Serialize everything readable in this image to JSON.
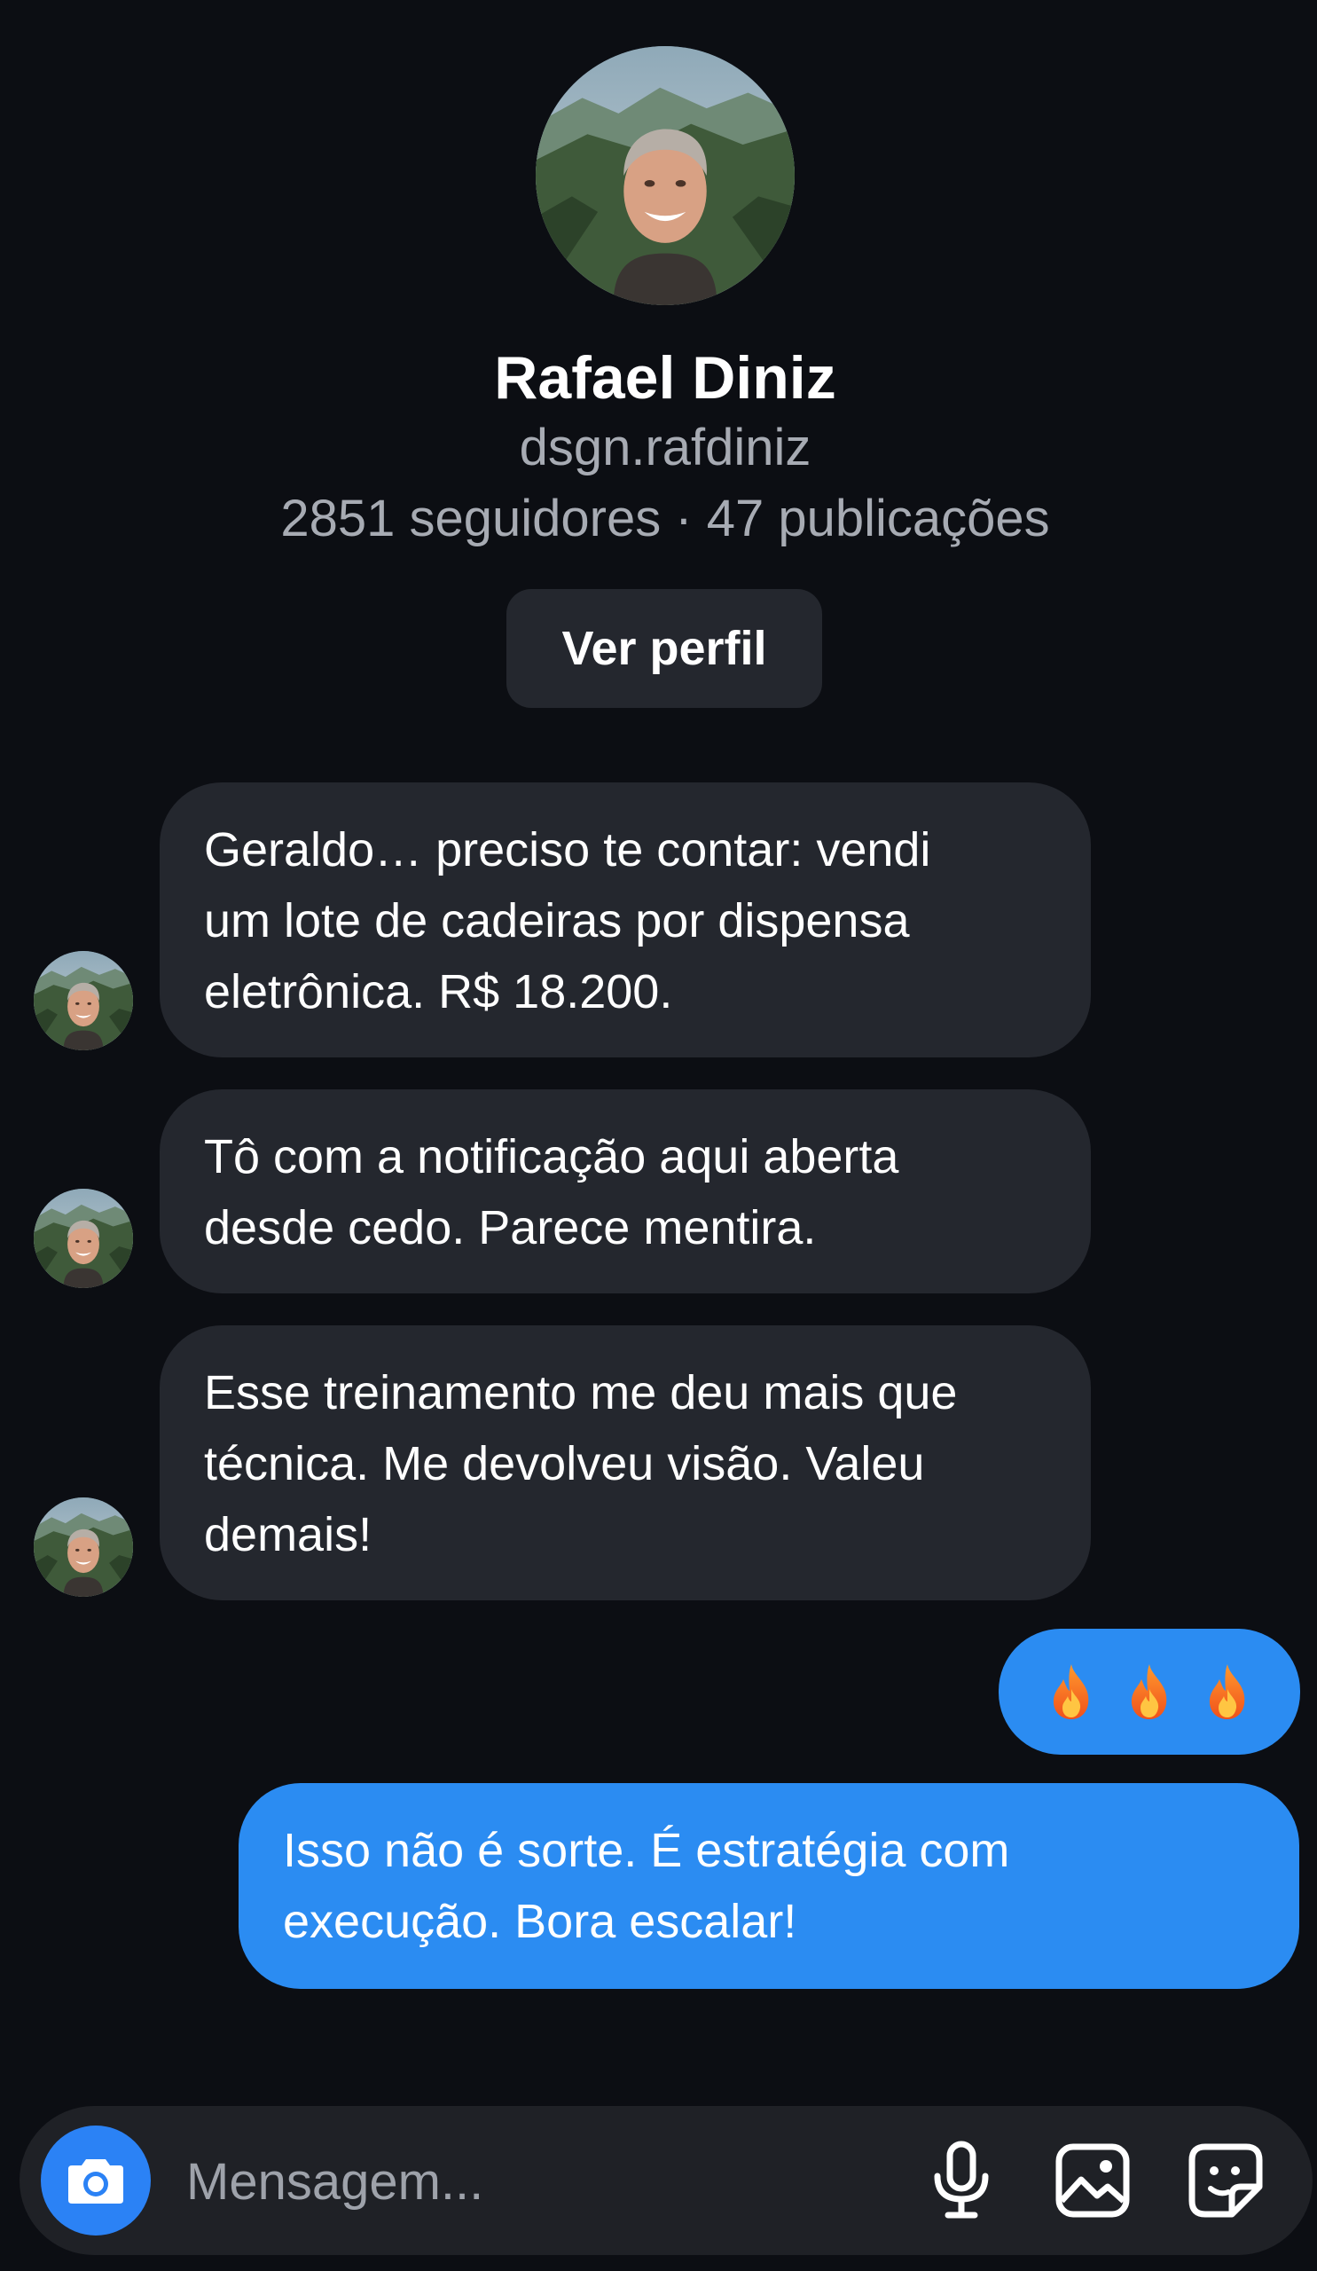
{
  "profile": {
    "name": "Rafael Diniz",
    "handle": "dsgn.rafdiniz",
    "stats": "2851 seguidores · 47 publicações",
    "view_profile_label": "Ver perfil"
  },
  "messages": [
    {
      "direction": "incoming",
      "text": "Geraldo… preciso te contar: vendi\num lote de cadeiras por dispensa\neletrônica. R$ 18.200."
    },
    {
      "direction": "incoming",
      "text": "Tô com a notificação aqui aberta\ndesde cedo. Parece mentira."
    },
    {
      "direction": "incoming",
      "text": "Esse treinamento me deu mais que\ntécnica. Me devolveu visão. Valeu\ndemais!"
    },
    {
      "direction": "outgoing",
      "content": "fire-icon x3"
    },
    {
      "direction": "outgoing",
      "text": "Isso não é sorte. É estratégia com\nexecução. Bora escalar!"
    }
  ],
  "composer": {
    "placeholder": "Mensagem...",
    "icons": [
      "camera-icon",
      "microphone-icon",
      "image-icon",
      "sticker-icon"
    ]
  },
  "colors": {
    "background": "#0c0e13",
    "incoming_bubble": "#24272e",
    "outgoing_bubble": "#2b8cf2",
    "camera_button": "#2b82f5",
    "secondary_text": "#a7abb3"
  }
}
